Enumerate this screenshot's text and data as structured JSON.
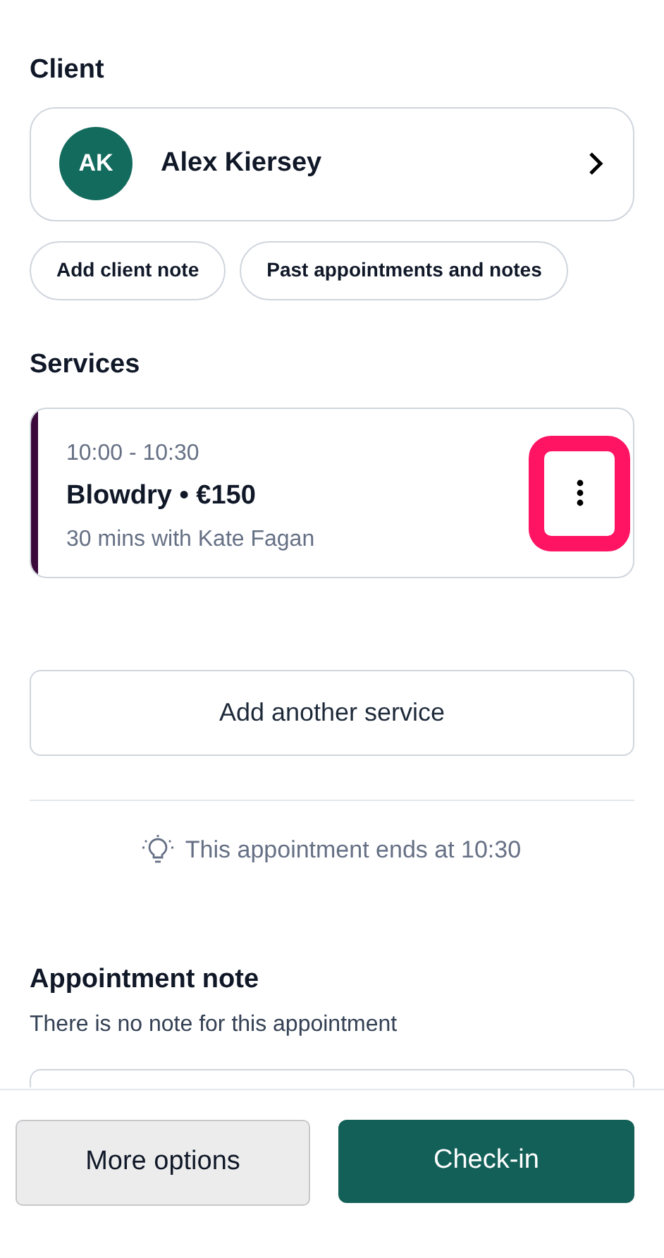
{
  "client": {
    "heading": "Client",
    "initials": "AK",
    "name": "Alex Kiersey",
    "actions": [
      "Add client note",
      "Past appointments and notes"
    ]
  },
  "services": {
    "heading": "Services",
    "items": [
      {
        "time": "10:00 - 10:30",
        "title": "Blowdry • €150",
        "detail": "30 mins with Kate Fagan",
        "color": "#3b0a3a",
        "highlighted": true
      }
    ],
    "add_label": "Add another service"
  },
  "hint": "This appointment ends at 10:30",
  "note": {
    "heading": "Appointment note",
    "text": "There is no note for this appointment"
  },
  "footer": {
    "secondary": "More options",
    "primary": "Check-in"
  }
}
